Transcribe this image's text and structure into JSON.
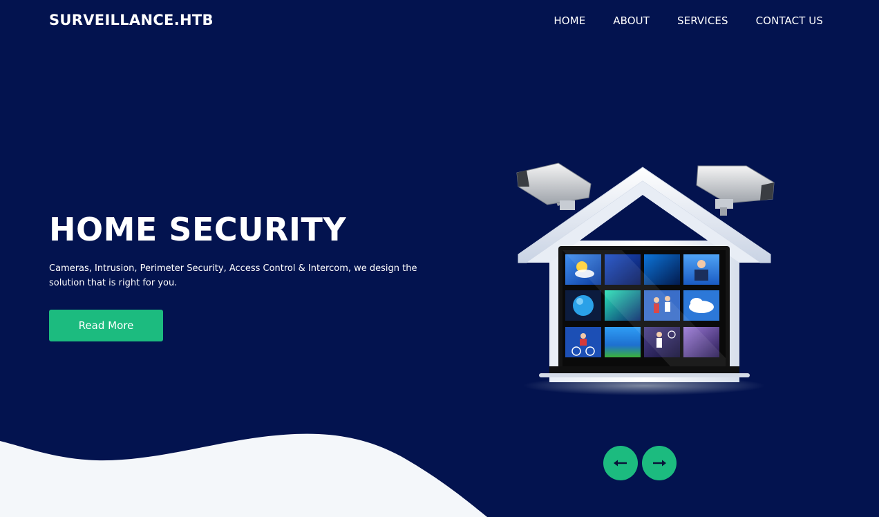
{
  "header": {
    "brand": "SURVEILLANCE.HTB",
    "nav": [
      {
        "label": "HOME"
      },
      {
        "label": "ABOUT"
      },
      {
        "label": "SERVICES"
      },
      {
        "label": "CONTACT US"
      }
    ]
  },
  "hero": {
    "title": "HOME SECURITY",
    "description": "Cameras, Intrusion, Perimeter Security, Access Control & Intercom, we design the solution that is right for you.",
    "button_label": "Read More"
  },
  "carousel": {
    "prev_icon": "arrow-left-icon",
    "next_icon": "arrow-right-icon"
  },
  "colors": {
    "background": "#03134f",
    "accent": "#1cbb7f",
    "text": "#ffffff",
    "wave": "#f4f7fa"
  }
}
